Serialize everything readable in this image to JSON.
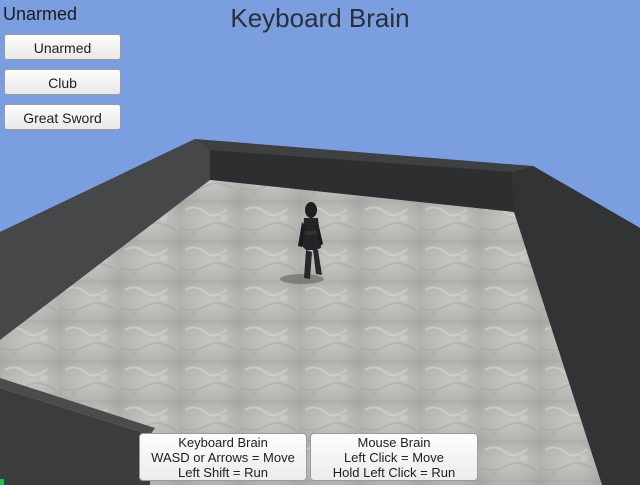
{
  "hud": {
    "current_weapon": "Unarmed",
    "title": "Keyboard Brain"
  },
  "weapon_buttons": [
    {
      "label": "Unarmed"
    },
    {
      "label": "Club"
    },
    {
      "label": "Great Sword"
    }
  ],
  "help_panels": {
    "keyboard": {
      "heading": "Keyboard Brain",
      "line1": "WASD or Arrows = Move",
      "line2": "Left Shift = Run"
    },
    "mouse": {
      "heading": "Mouse Brain",
      "line1": "Left Click = Move",
      "line2": "Hold Left Click = Run"
    }
  },
  "colors": {
    "sky": "#7b9ee0",
    "wall_top": "#3c3e3f",
    "wall_inner": "#2a2c2d",
    "floor": "#b9bcb6"
  }
}
